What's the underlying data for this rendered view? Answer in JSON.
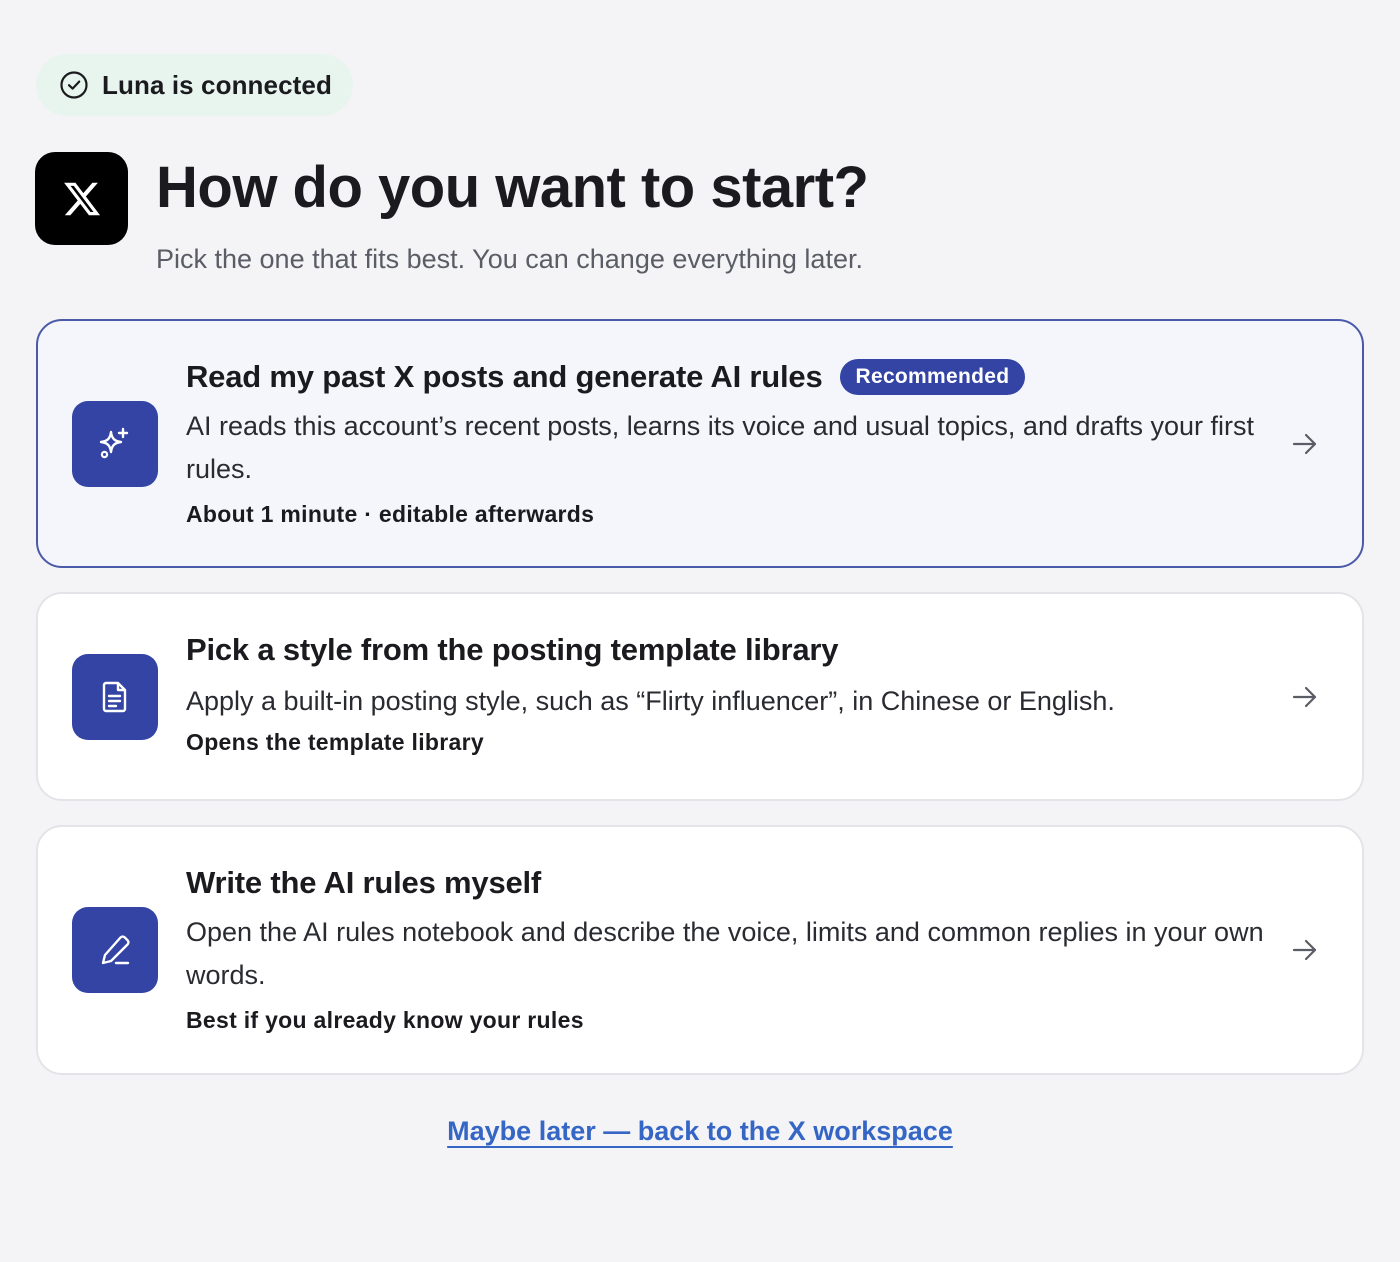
{
  "status": {
    "text": "Luna is connected",
    "icon": "check-circle-icon"
  },
  "header": {
    "logo": "x-logo",
    "title": "How do you want to start?",
    "subtitle": "Pick the one that fits best. You can change everything later."
  },
  "options": [
    {
      "icon": "sparkle-icon",
      "title": "Read my past X posts and generate AI rules",
      "badge": "Recommended",
      "description": "AI reads this account’s recent posts, learns its voice and usual topics, and drafts your first rules.",
      "note": "About 1 minute · editable afterwards"
    },
    {
      "icon": "document-icon",
      "title": "Pick a style from the posting template library",
      "description": "Apply a built-in posting style, such as “Flirty influencer”, in Chinese or English.",
      "note": "Opens the template library"
    },
    {
      "icon": "pencil-icon",
      "title": "Write the AI rules myself",
      "description": "Open the AI rules notebook and describe the voice, limits and common replies in your own words.",
      "note": "Best if you already know your rules"
    }
  ],
  "footer": {
    "back_link": "Maybe later — back to the X workspace"
  },
  "colors": {
    "accent": "#3344a4",
    "link": "#3566c5",
    "status_bg": "#e8f5ee",
    "background": "#f4f4f6"
  }
}
